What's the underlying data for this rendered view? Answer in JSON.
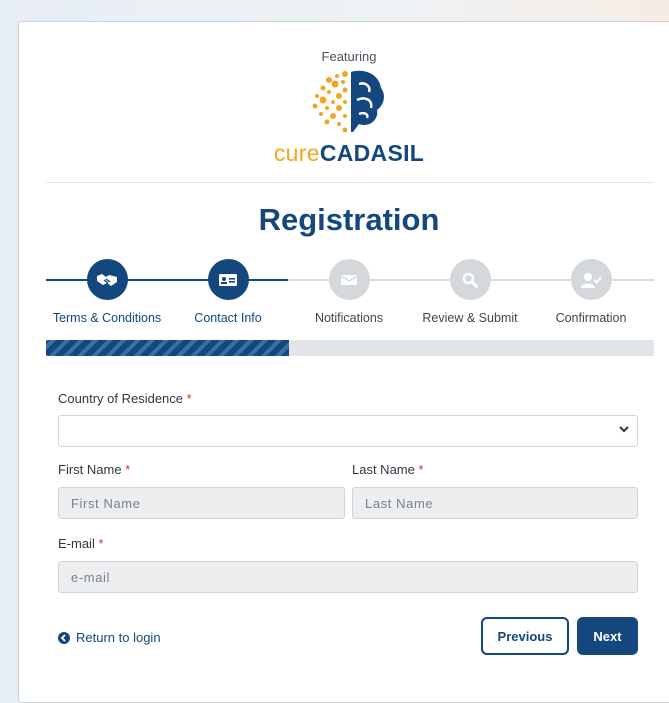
{
  "brand": {
    "featuring": "Featuring",
    "cure": "cure",
    "cadasil": "CADASIL"
  },
  "page": {
    "title": "Registration"
  },
  "steps": [
    {
      "label": "Terms & Conditions",
      "icon": "handshake-icon",
      "state": "done"
    },
    {
      "label": "Contact Info",
      "icon": "id-card-icon",
      "state": "current"
    },
    {
      "label": "Notifications",
      "icon": "envelope-icon",
      "state": "todo"
    },
    {
      "label": "Review & Submit",
      "icon": "magnifier-icon",
      "state": "todo"
    },
    {
      "label": "Confirmation",
      "icon": "user-check-icon",
      "state": "todo"
    }
  ],
  "progress": {
    "fraction": 0.4
  },
  "form": {
    "country": {
      "label": "Country of Residence",
      "required": "*",
      "value": ""
    },
    "first_name": {
      "label": "First Name",
      "required": "*",
      "placeholder": "First Name"
    },
    "last_name": {
      "label": "Last Name",
      "required": "*",
      "placeholder": "Last Name"
    },
    "email": {
      "label": "E-mail",
      "required": "*",
      "placeholder": "e-mail"
    }
  },
  "actions": {
    "return_label": "Return to login",
    "previous": "Previous",
    "next": "Next"
  },
  "colors": {
    "primary": "#13477d",
    "accent": "#f0a623",
    "inactive": "#d4d8db",
    "required": "#d0342c"
  }
}
